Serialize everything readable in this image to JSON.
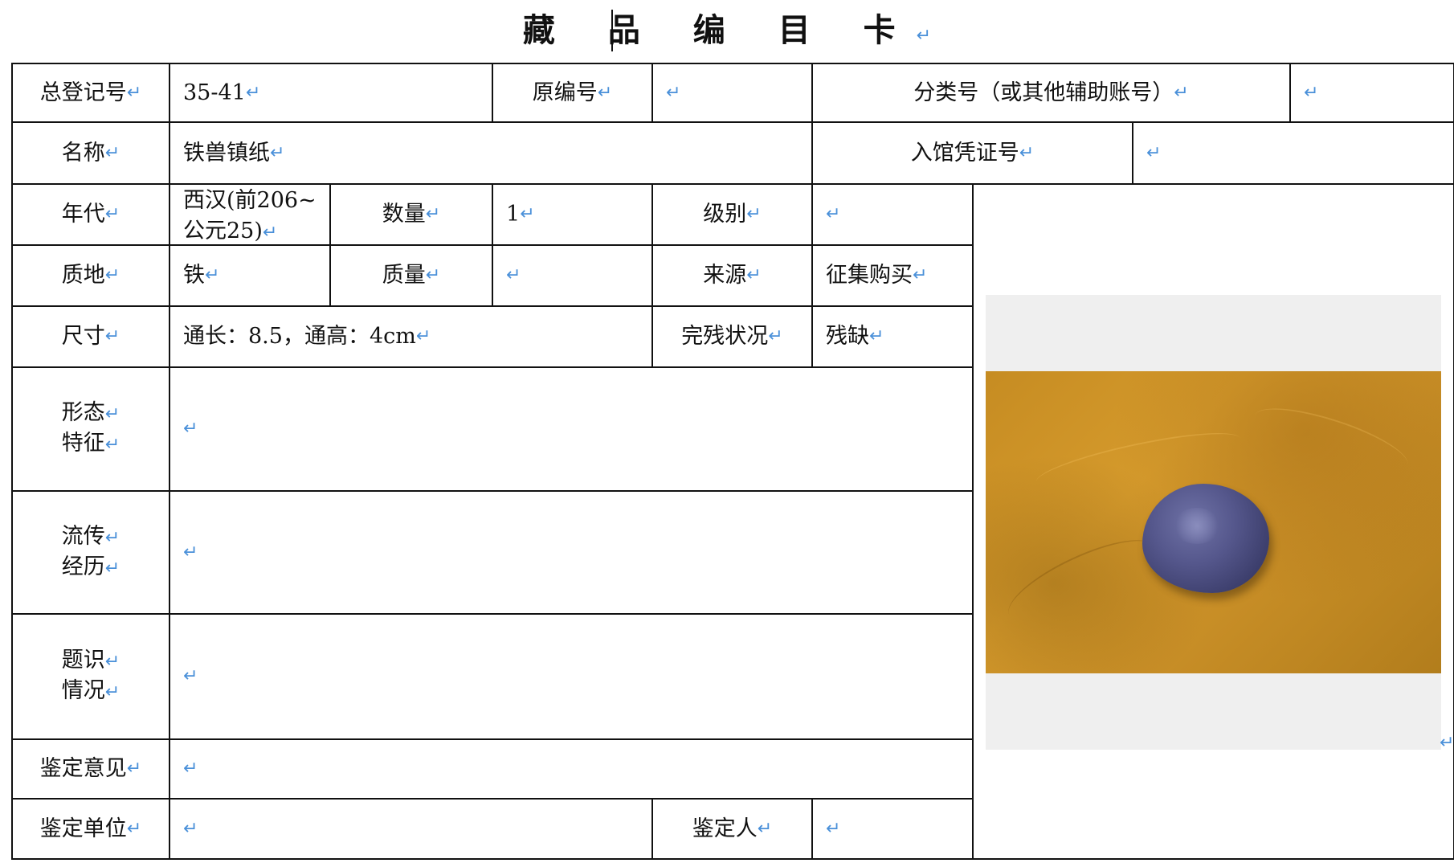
{
  "title": "藏 品 编 目 卡",
  "para_mark": "↵",
  "rows": {
    "r1": {
      "label_total_reg": "总登记号",
      "total_reg": "35-41",
      "label_orig_no": "原编号",
      "orig_no": "",
      "label_class_no": "分类号（或其他辅助账号）",
      "class_no": ""
    },
    "r2": {
      "label_name": "名称",
      "name": "铁兽镇纸",
      "label_entry_no": "入馆凭证号",
      "entry_no": ""
    },
    "r3": {
      "label_era": "年代",
      "era_line1": "西汉(前206~",
      "era_line2": "公元25)",
      "label_qty": "数量",
      "qty": "1",
      "label_level": "级别",
      "level": ""
    },
    "r4": {
      "label_material": "质地",
      "material": "铁",
      "label_mass": "质量",
      "mass": "",
      "label_source": "来源",
      "source": "征集购买"
    },
    "r5": {
      "label_size": "尺寸",
      "size": "通长：8.5，通高：4cm",
      "label_condition": "完残状况",
      "condition": "残缺"
    },
    "r6": {
      "label_form_1": "形态",
      "label_form_2": "特征",
      "form": ""
    },
    "r7": {
      "label_history_1": "流传",
      "label_history_2": "经历",
      "history": ""
    },
    "r8": {
      "label_inscription_1": "题识",
      "label_inscription_2": "情况",
      "inscription": ""
    },
    "r9": {
      "label_appraisal": "鉴定意见",
      "appraisal": ""
    },
    "r10": {
      "label_unit": "鉴定单位",
      "unit": "",
      "label_appraiser": "鉴定人",
      "appraiser": ""
    }
  },
  "photo": {
    "subject": "iron beast paperweight on ochre cloth",
    "background_color": "#c98f27",
    "object_color": "#4a4c80"
  }
}
